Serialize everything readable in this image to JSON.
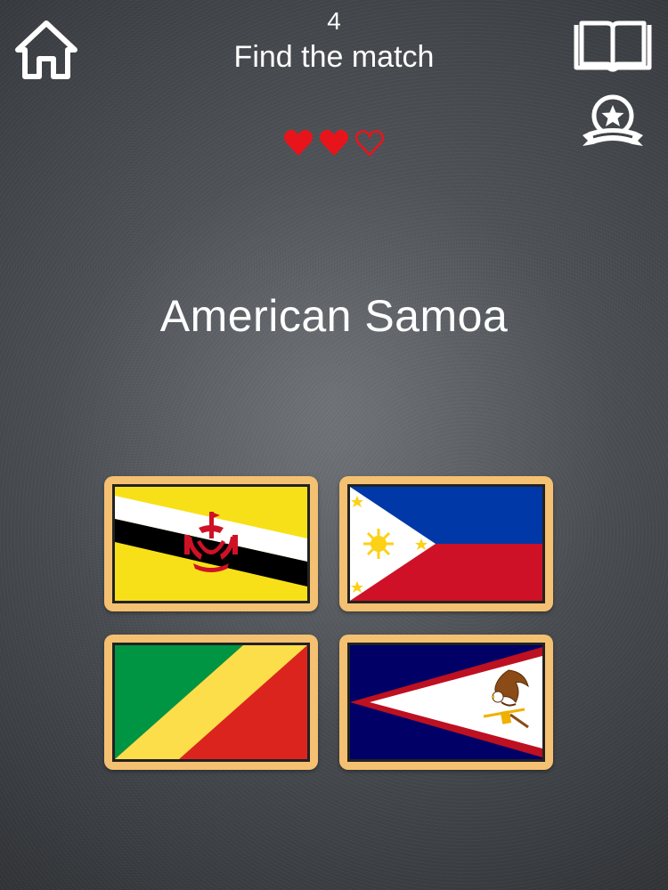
{
  "header": {
    "level": "4",
    "prompt": "Find the match"
  },
  "icons": {
    "home": "home-icon",
    "book": "book-icon",
    "rank": "award-ribbon-icon"
  },
  "lives": {
    "total": 3,
    "remaining": 2,
    "color": "#e8141c"
  },
  "question": {
    "country": "American Samoa"
  },
  "options": [
    {
      "flag": "Brunei"
    },
    {
      "flag": "Philippines"
    },
    {
      "flag": "Republic of the Congo"
    },
    {
      "flag": "American Samoa"
    }
  ],
  "colors": {
    "card_border": "#f4c071",
    "text": "#ffffff"
  }
}
